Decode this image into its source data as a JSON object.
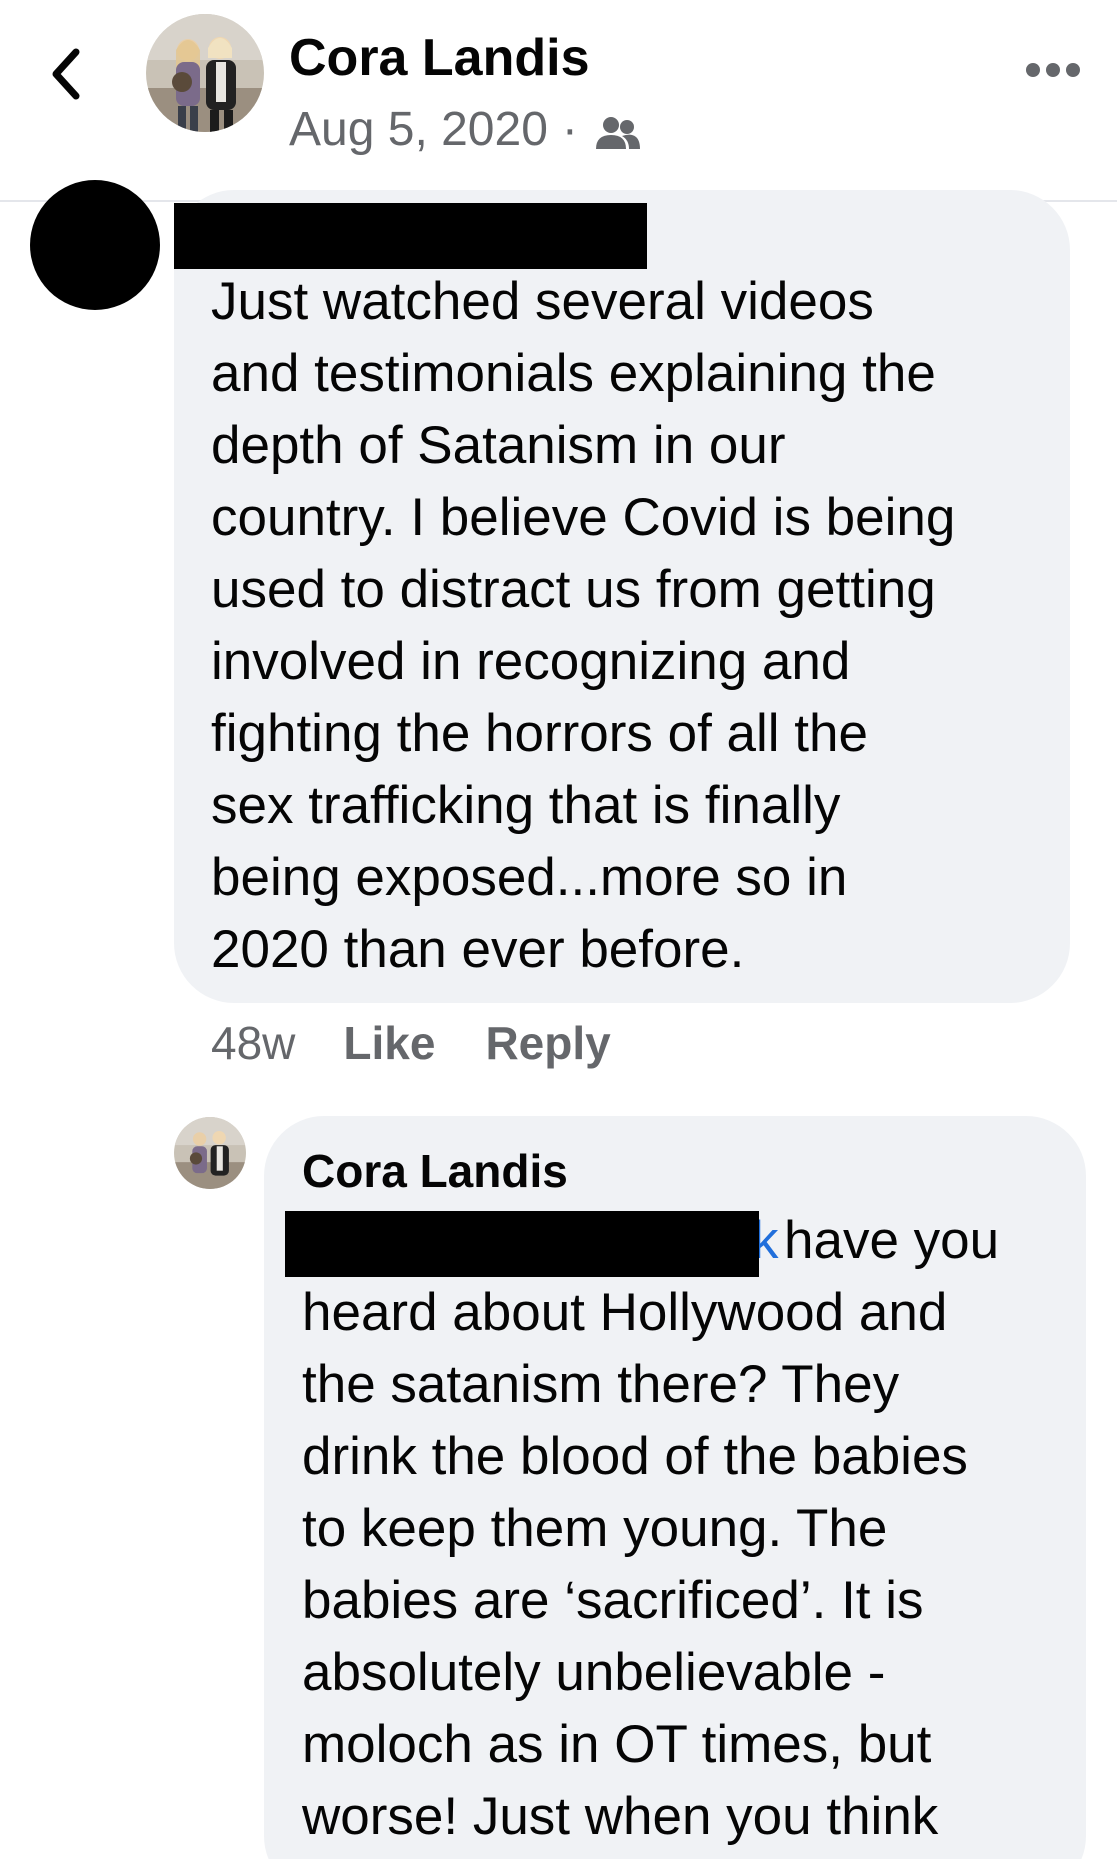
{
  "header": {
    "author_name": "Cora Landis",
    "post_date": "Aug 5, 2020",
    "separator": "·",
    "audience_icon": "friends-icon",
    "back_icon": "chevron-left-icon",
    "more_icon": "more-horizontal-icon"
  },
  "comment": {
    "author_redacted": true,
    "lines": [
      "Just watched several videos",
      "and testimonials explaining the",
      "depth of Satanism in our",
      "country. I believe Covid is being",
      "used to distract us from getting",
      "involved in recognizing and",
      "fighting the horrors of all the",
      "sex trafficking that is finally",
      "being exposed...more so in",
      "2020 than ever before."
    ],
    "time": "48w",
    "like_label": "Like",
    "reply_label": "Reply"
  },
  "reply": {
    "author_name": "Cora Landis",
    "mention_visible_tail": "k",
    "first_line_text": "have you",
    "lines": [
      "heard about Hollywood and",
      "the satanism there?  They",
      "drink the blood of the babies",
      "to keep them young.  The",
      "babies are ‘sacrificed’.  It is",
      "absolutely unbelievable -",
      "moloch as in OT times, but",
      "worse!  Just when you think"
    ]
  },
  "colors": {
    "bubble_bg": "#f0f2f5",
    "secondary_text": "#65676b",
    "mention_blue": "#216fdb",
    "redaction": "#000000"
  }
}
